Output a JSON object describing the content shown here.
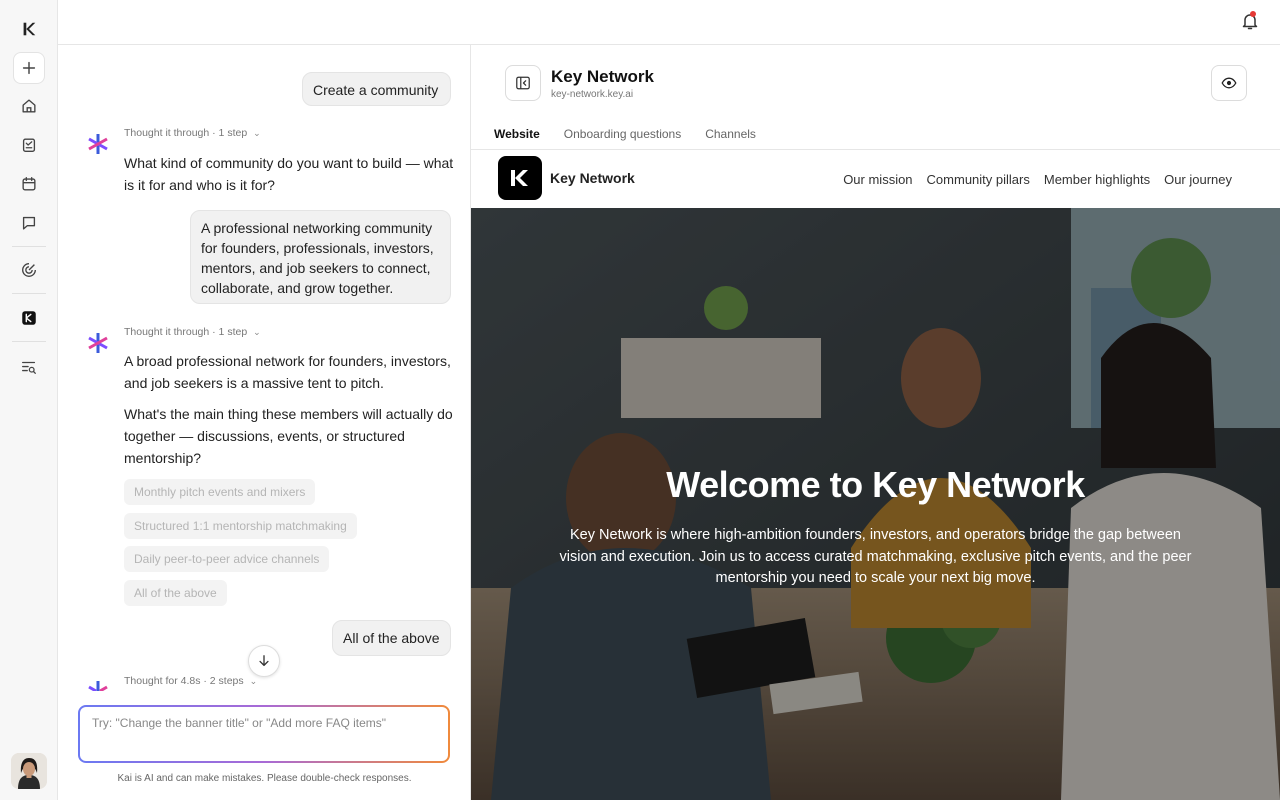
{
  "rail": {
    "items": [
      "new",
      "home",
      "tasks",
      "calendar",
      "messages",
      "analytics",
      "community",
      "search-list"
    ]
  },
  "chat": {
    "messages": [
      {
        "role": "user",
        "text": "Create a community"
      },
      {
        "role": "assistant",
        "thought": "Thought it through · 1 step",
        "paragraphs": [
          "What kind of community do you want to build — what is it for and who is it for?"
        ]
      },
      {
        "role": "user",
        "text": "A professional networking community for founders, professionals, investors, mentors, and job seekers to connect, collaborate, and grow together."
      },
      {
        "role": "assistant",
        "thought": "Thought it through · 1 step",
        "paragraphs": [
          "A broad professional network for founders, investors, and job seekers is a massive tent to pitch.",
          "What's the main thing these members will actually do together — discussions, events, or structured mentorship?"
        ]
      },
      {
        "role": "user",
        "text": "All of the above"
      },
      {
        "role": "assistant",
        "thought": "Thought for 4.8s · 2 steps"
      }
    ],
    "options": [
      "Monthly pitch events and mixers",
      "Structured 1:1 mentorship matchmaking",
      "Daily peer-to-peer advice channels",
      "All of the above"
    ],
    "composer_placeholder": "Try: \"Change the banner title\" or \"Add more FAQ items\"",
    "disclaimer": "Kai is AI and can make mistakes. Please double-check responses."
  },
  "preview": {
    "title": "Key Network",
    "url": "key-network.key.ai",
    "tabs": [
      "Website",
      "Onboarding questions",
      "Channels"
    ],
    "active_tab": "Website"
  },
  "site": {
    "name": "Key Network",
    "nav": [
      "Our mission",
      "Community pillars",
      "Member highlights",
      "Our journey"
    ],
    "hero_title": "Welcome to Key Network",
    "hero_body": "Key Network is where high-ambition founders, investors, and operators bridge the gap between vision and execution. Join us to access curated matchmaking, exclusive pitch events, and the peer mentorship you need to scale your next big move."
  },
  "colors": {
    "accent_gradient": [
      "#6b79f2",
      "#a86ad6",
      "#f08a3c"
    ],
    "kai_logo": [
      "#3b5bdb",
      "#e0409a",
      "#7c4dff"
    ],
    "notification_dot": "#e53935"
  }
}
